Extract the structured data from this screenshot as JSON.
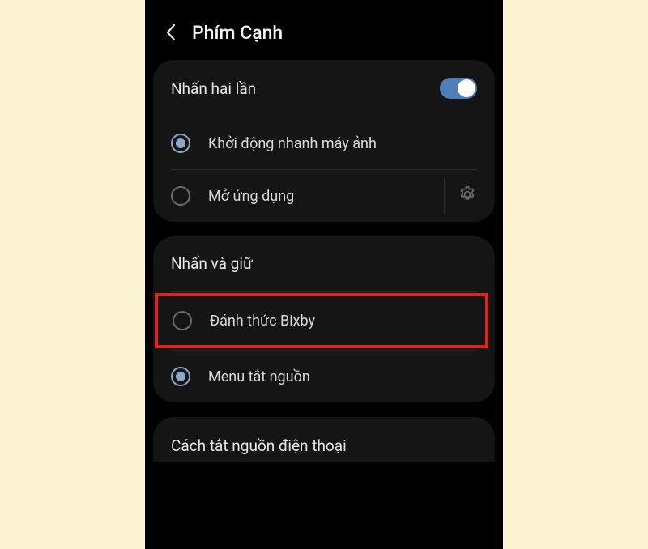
{
  "header": {
    "title": "Phím Cạnh"
  },
  "section1": {
    "title": "Nhấn hai lần",
    "option_camera": "Khởi động nhanh máy ảnh",
    "option_openapp": "Mở ứng dụng"
  },
  "section2": {
    "title": "Nhấn và giữ",
    "option_bixby": "Đánh thức Bixby",
    "option_powermenu": "Menu tắt nguồn"
  },
  "footer": {
    "label": "Cách tắt nguồn điện thoại"
  }
}
